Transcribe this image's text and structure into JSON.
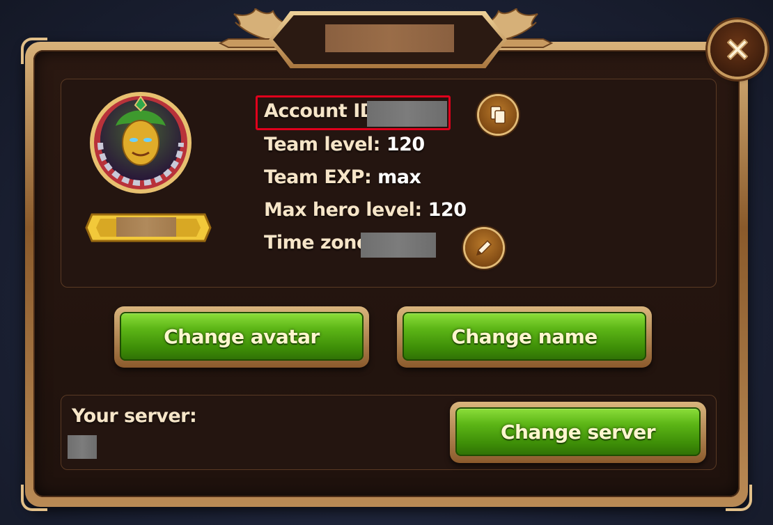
{
  "profile": {
    "account_id_label": "Account ID:",
    "team_level_label": "Team level:",
    "team_level_value": "120",
    "team_exp_label": "Team EXP:",
    "team_exp_value": "max",
    "max_hero_level_label": "Max hero level:",
    "max_hero_level_value": "120",
    "time_zone_label": "Time zone:"
  },
  "buttons": {
    "change_avatar": "Change avatar",
    "change_name": "Change name",
    "change_server": "Change server"
  },
  "server": {
    "label": "Your server:"
  },
  "icons": {
    "close": "close-icon",
    "copy": "copy-icon",
    "edit": "pencil-icon",
    "avatar": "hero-avatar"
  },
  "colors": {
    "highlight": "#e0001c",
    "button_green": "#5cb516",
    "text": "#f6e5c8",
    "frame_gold": "#d9b57d"
  }
}
